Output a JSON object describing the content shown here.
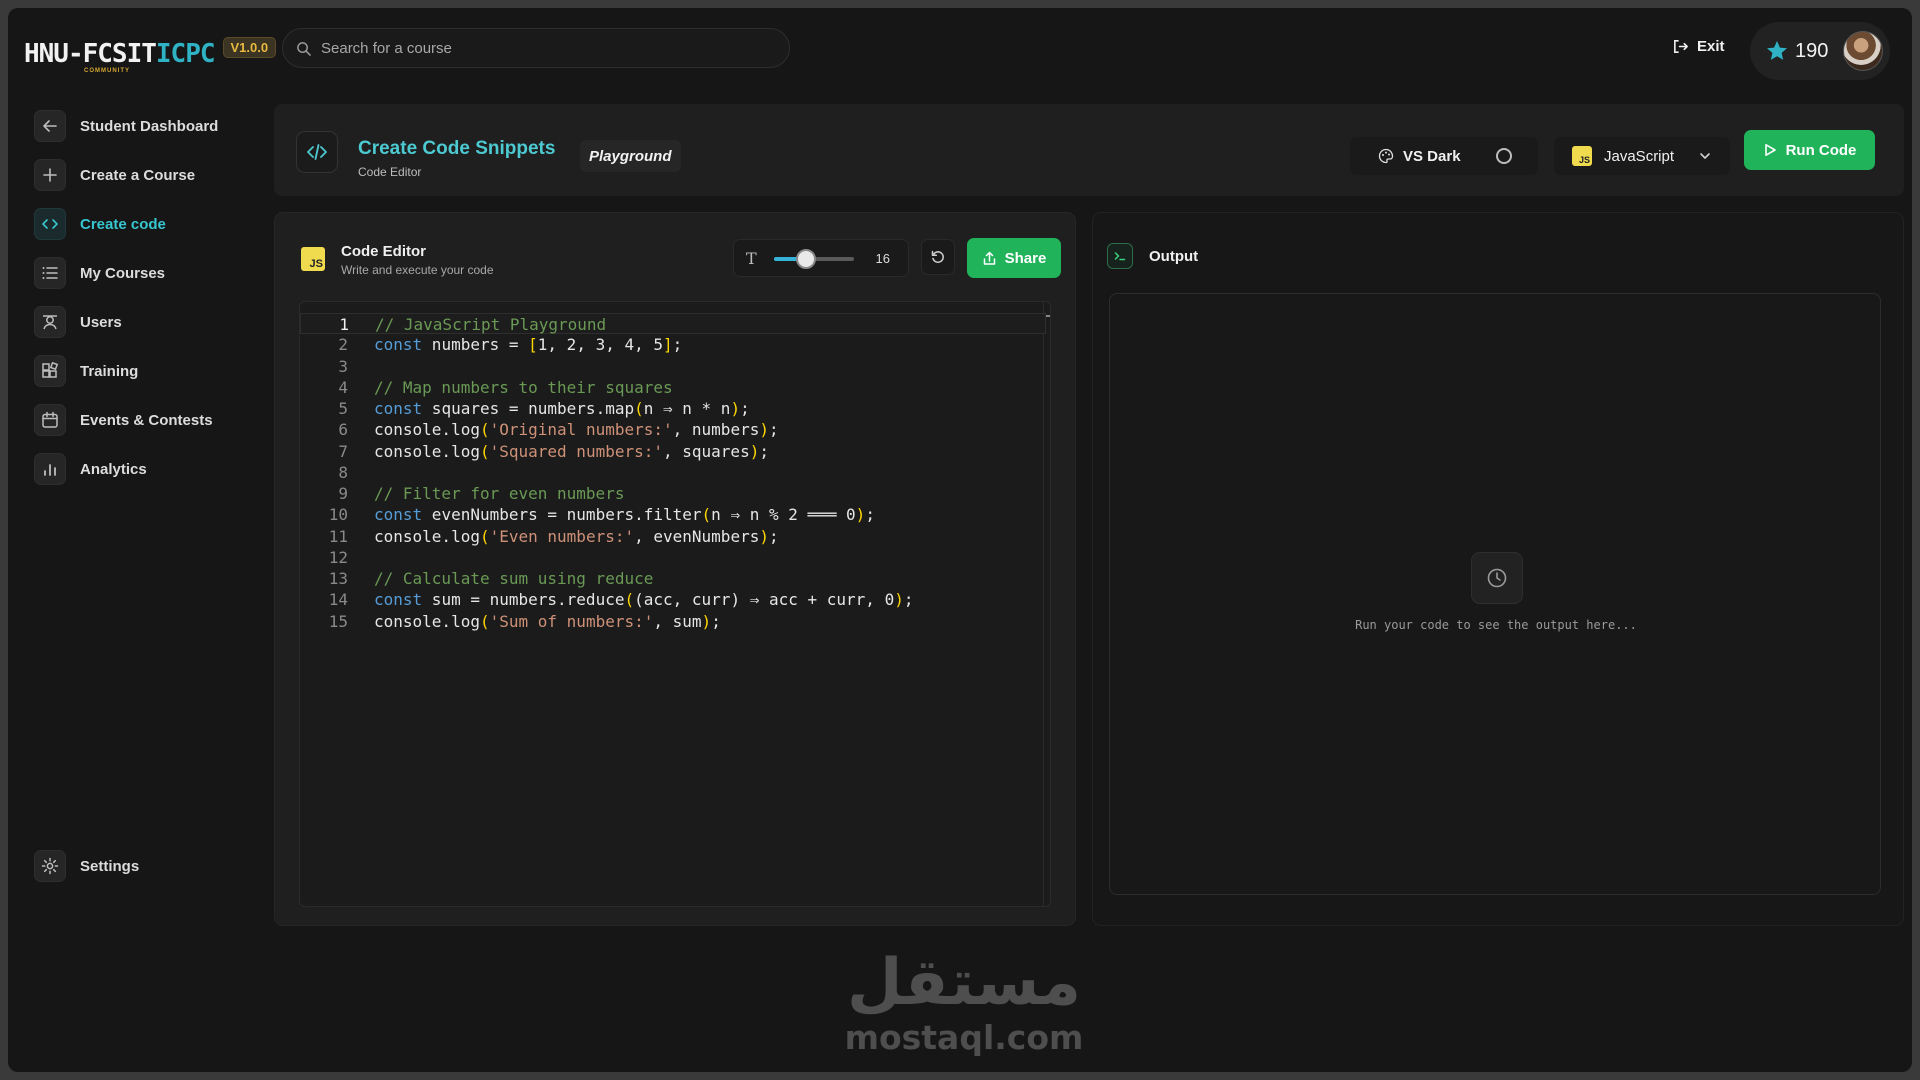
{
  "brand": {
    "logo_text_a": "HNU-FCSIT",
    "logo_text_b": "ICPC",
    "logo_sub": "COMMUNITY",
    "version": "V1.0.0"
  },
  "search": {
    "placeholder": "Search for a course",
    "value": ""
  },
  "topbar": {
    "exit_label": "Exit",
    "points": "190",
    "star_color": "#2fb3c4"
  },
  "sidebar": {
    "items": [
      {
        "label": "Student Dashboard",
        "icon": "arrow-left-icon"
      },
      {
        "label": "Create a Course",
        "icon": "plus-icon"
      },
      {
        "label": "Create code",
        "icon": "code-icon",
        "active": true
      },
      {
        "label": "My Courses",
        "icon": "list-icon"
      },
      {
        "label": "Users",
        "icon": "user-badge-icon"
      },
      {
        "label": "Training",
        "icon": "blocks-icon"
      },
      {
        "label": "Events & Contests",
        "icon": "calendar-icon"
      },
      {
        "label": "Analytics",
        "icon": "bar-chart-icon"
      }
    ],
    "settings_label": "Settings"
  },
  "header": {
    "title": "Create Code Snippets",
    "subtitle": "Code Editor",
    "badge": "Playground",
    "theme_label": "VS Dark",
    "language": "JavaScript",
    "language_badge": "JS",
    "run_label": "Run Code",
    "accent": "#4cc9d1",
    "run_color": "#21b35a"
  },
  "editor": {
    "badge": "JS",
    "title": "Code Editor",
    "subtitle": "Write and execute your code",
    "font_size_icon": "T",
    "font_size": "16",
    "font_size_fraction": 0.4,
    "share_label": "Share",
    "current_line": 1,
    "lines": [
      {
        "n": "1",
        "tokens": [
          [
            "com",
            "// JavaScript Playground"
          ]
        ]
      },
      {
        "n": "2",
        "tokens": [
          [
            "kw",
            "const"
          ],
          [
            "pl",
            " numbers = "
          ],
          [
            "br",
            "["
          ],
          [
            "pl",
            "1, 2, 3, 4, 5"
          ],
          [
            "br",
            "]"
          ],
          [
            "pl",
            ";"
          ]
        ]
      },
      {
        "n": "3",
        "tokens": []
      },
      {
        "n": "4",
        "tokens": [
          [
            "com",
            "// Map numbers to their squares"
          ]
        ]
      },
      {
        "n": "5",
        "tokens": [
          [
            "kw",
            "const"
          ],
          [
            "pl",
            " squares = numbers.map"
          ],
          [
            "br",
            "("
          ],
          [
            "pl",
            "n ⇒ n * n"
          ],
          [
            "br",
            ")"
          ],
          [
            "pl",
            ";"
          ]
        ]
      },
      {
        "n": "6",
        "tokens": [
          [
            "pl",
            "console.log"
          ],
          [
            "br",
            "("
          ],
          [
            "str",
            "'Original numbers:'"
          ],
          [
            "pl",
            ", numbers"
          ],
          [
            "br",
            ")"
          ],
          [
            "pl",
            ";"
          ]
        ]
      },
      {
        "n": "7",
        "tokens": [
          [
            "pl",
            "console.log"
          ],
          [
            "br",
            "("
          ],
          [
            "str",
            "'Squared numbers:'"
          ],
          [
            "pl",
            ", squares"
          ],
          [
            "br",
            ")"
          ],
          [
            "pl",
            ";"
          ]
        ]
      },
      {
        "n": "8",
        "tokens": []
      },
      {
        "n": "9",
        "tokens": [
          [
            "com",
            "// Filter for even numbers"
          ]
        ]
      },
      {
        "n": "10",
        "tokens": [
          [
            "kw",
            "const"
          ],
          [
            "pl",
            " evenNumbers = numbers.filter"
          ],
          [
            "br",
            "("
          ],
          [
            "pl",
            "n ⇒ n % 2 ═══ 0"
          ],
          [
            "br",
            ")"
          ],
          [
            "pl",
            ";"
          ]
        ]
      },
      {
        "n": "11",
        "tokens": [
          [
            "pl",
            "console.log"
          ],
          [
            "br",
            "("
          ],
          [
            "str",
            "'Even numbers:'"
          ],
          [
            "pl",
            ", evenNumbers"
          ],
          [
            "br",
            ")"
          ],
          [
            "pl",
            ";"
          ]
        ]
      },
      {
        "n": "12",
        "tokens": []
      },
      {
        "n": "13",
        "tokens": [
          [
            "com",
            "// Calculate sum using reduce"
          ]
        ]
      },
      {
        "n": "14",
        "tokens": [
          [
            "kw",
            "const"
          ],
          [
            "pl",
            " sum = numbers.reduce"
          ],
          [
            "br",
            "("
          ],
          [
            "pl",
            "(acc, curr) ⇒ acc + curr, 0"
          ],
          [
            "br",
            ")"
          ],
          [
            "pl",
            ";"
          ]
        ]
      },
      {
        "n": "15",
        "tokens": [
          [
            "pl",
            "console.log"
          ],
          [
            "br",
            "("
          ],
          [
            "str",
            "'Sum of numbers:'"
          ],
          [
            "pl",
            ", sum"
          ],
          [
            "br",
            ")"
          ],
          [
            "pl",
            ";"
          ]
        ]
      }
    ]
  },
  "output": {
    "title": "Output",
    "placeholder": "Run your code to see the output here..."
  },
  "watermark": {
    "arabic": "مستقل",
    "latin": "mostaql.com"
  }
}
